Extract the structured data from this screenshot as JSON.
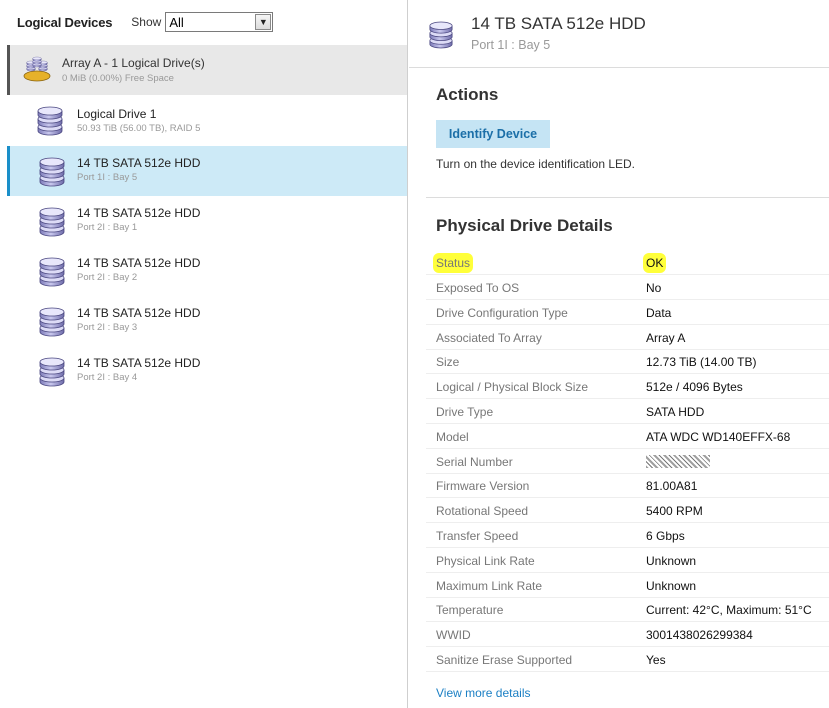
{
  "left": {
    "title": "Logical Devices",
    "show_label": "Show",
    "filter_value": "All",
    "array": {
      "name": "Array A - 1 Logical Drive(s)",
      "sub": "0 MiB (0.00%) Free Space"
    },
    "logical_drive": {
      "name": "Logical Drive 1",
      "sub": "50.93 TiB (56.00 TB), RAID 5"
    },
    "drives": [
      {
        "name": "14 TB SATA 512e HDD",
        "sub": "Port 1I : Bay 5",
        "selected": true
      },
      {
        "name": "14 TB SATA 512e HDD",
        "sub": "Port 2I : Bay 1",
        "selected": false
      },
      {
        "name": "14 TB SATA 512e HDD",
        "sub": "Port 2I : Bay 2",
        "selected": false
      },
      {
        "name": "14 TB SATA 512e HDD",
        "sub": "Port 2I : Bay 3",
        "selected": false
      },
      {
        "name": "14 TB SATA 512e HDD",
        "sub": "Port 2I : Bay 4",
        "selected": false
      }
    ]
  },
  "header": {
    "name": "14 TB SATA 512e HDD",
    "sub": "Port 1I : Bay 5"
  },
  "actions": {
    "title": "Actions",
    "identify_label": "Identify Device",
    "identify_desc": "Turn on the device identification LED."
  },
  "details": {
    "title": "Physical Drive Details",
    "rows": [
      {
        "key": "Status",
        "value": "OK"
      },
      {
        "key": "Exposed To OS",
        "value": "No"
      },
      {
        "key": "Drive Configuration Type",
        "value": "Data"
      },
      {
        "key": "Associated To Array",
        "value": "Array A"
      },
      {
        "key": "Size",
        "value": "12.73 TiB (14.00 TB)"
      },
      {
        "key": "Logical / Physical Block Size",
        "value": "512e / 4096 Bytes"
      },
      {
        "key": "Drive Type",
        "value": "SATA HDD"
      },
      {
        "key": "Model",
        "value": "ATA WDC WD140EFFX-68"
      },
      {
        "key": "Serial Number",
        "value": ""
      },
      {
        "key": "Firmware Version",
        "value": "81.00A81"
      },
      {
        "key": "Rotational Speed",
        "value": "5400 RPM"
      },
      {
        "key": "Transfer Speed",
        "value": "6 Gbps"
      },
      {
        "key": "Physical Link Rate",
        "value": "Unknown"
      },
      {
        "key": "Maximum Link Rate",
        "value": "Unknown"
      },
      {
        "key": "Temperature",
        "value": "Current: 42°C, Maximum: 51°C"
      },
      {
        "key": "WWID",
        "value": "3001438026299384"
      },
      {
        "key": "Sanitize Erase Supported",
        "value": "Yes"
      }
    ],
    "more_label": "View more details"
  },
  "colors": {
    "accent": "#1a8fc9",
    "highlight": "#ffff3a",
    "selected_bg": "#cdeaf7",
    "button_bg": "#c5e4f4"
  },
  "icons": {
    "array": "array-icon",
    "drive": "disk-stack-icon",
    "dropdown": "chevron-down-icon"
  }
}
